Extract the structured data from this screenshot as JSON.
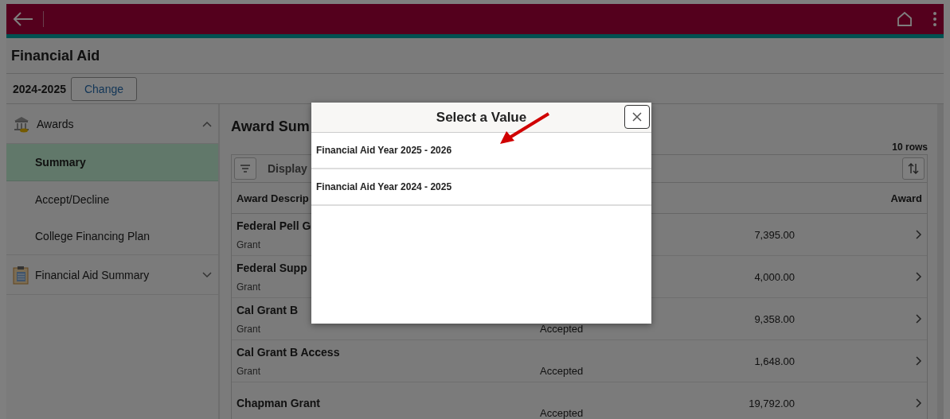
{
  "page_title": "Financial Aid",
  "year_bar": {
    "year": "2024-2025",
    "change_button": "Change"
  },
  "sidebar": {
    "sections": [
      {
        "label": "Awards",
        "expanded": true,
        "children": [
          {
            "label": "Summary",
            "selected": true
          },
          {
            "label": "Accept/Decline",
            "selected": false
          },
          {
            "label": "College Financing Plan",
            "selected": false
          }
        ]
      },
      {
        "label": "Financial Aid Summary",
        "expanded": false
      }
    ]
  },
  "content": {
    "title": "Award Sum",
    "row_count": "10 rows",
    "filter_label": "Display",
    "columns": [
      "Award Descrip",
      "Award"
    ],
    "rows": [
      {
        "name": "Federal Pell G",
        "type": "Grant",
        "amount": "7,395.00"
      },
      {
        "name": "Federal Supp",
        "type": "Grant",
        "amount": "4,000.00"
      },
      {
        "name": "Cal Grant B",
        "type": "Grant",
        "status": "Accepted",
        "amount": "9,358.00"
      },
      {
        "name": "Cal Grant B Access",
        "type": "Grant",
        "status": "Accepted",
        "amount": "1,648.00"
      },
      {
        "name": "Chapman Grant",
        "status": "Accepted",
        "amount": "19,792.00"
      }
    ]
  },
  "modal": {
    "title": "Select a Value",
    "options": [
      {
        "label": "Financial Aid Year 2025 - 2026"
      },
      {
        "label": "Financial Aid Year 2024 - 2025"
      }
    ]
  }
}
